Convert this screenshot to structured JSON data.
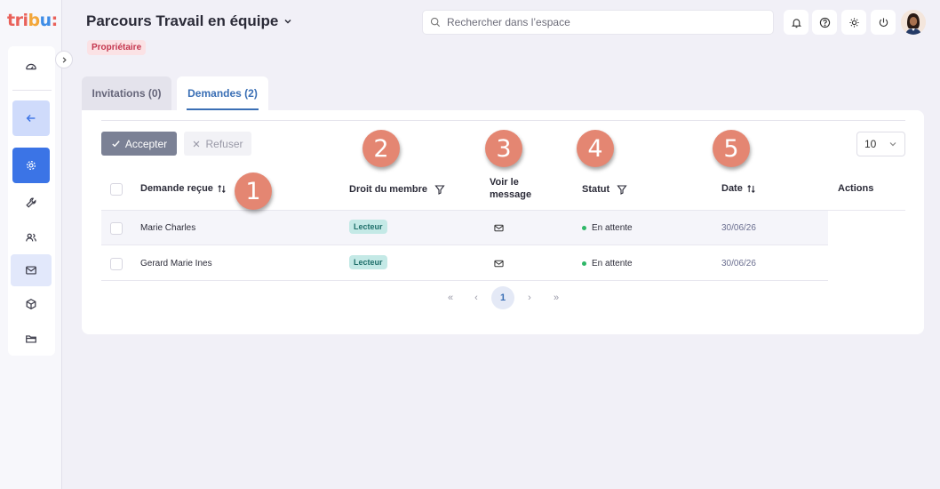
{
  "logo": {
    "p1": "tri",
    "p2": "b",
    "p3": "u",
    ":": ":"
  },
  "header": {
    "title": "Parcours Travail en équipe",
    "role_badge": "Propriétaire",
    "search_placeholder": "Rechercher dans l’espace"
  },
  "tabs": [
    {
      "label": "Invitations (0)",
      "active": false
    },
    {
      "label": "Demandes (2)",
      "active": true
    }
  ],
  "toolbar": {
    "accept_label": "Accepter",
    "refuse_label": "Refuser",
    "page_size": "10"
  },
  "table": {
    "columns": {
      "request": "Demande reçue",
      "role": "Droit du membre",
      "message": "Voir le message",
      "status": "Statut",
      "date": "Date",
      "actions": "Actions"
    },
    "rows": [
      {
        "name": "Marie Charles",
        "role": "Lecteur",
        "status": "En attente",
        "date": "30/06/26"
      },
      {
        "name": "Gerard Marie Ines",
        "role": "Lecteur",
        "status": "En attente",
        "date": "30/06/26"
      }
    ]
  },
  "pagination": {
    "first": "«",
    "prev": "‹",
    "current": "1",
    "next": "›",
    "last": "»"
  },
  "markers": [
    "1",
    "2",
    "3",
    "4",
    "5"
  ],
  "colors": {
    "accent": "#3a6fb5",
    "marker": "#e48672",
    "status_pending": "#2fb768",
    "sidebar_active": "#3b74e6"
  }
}
